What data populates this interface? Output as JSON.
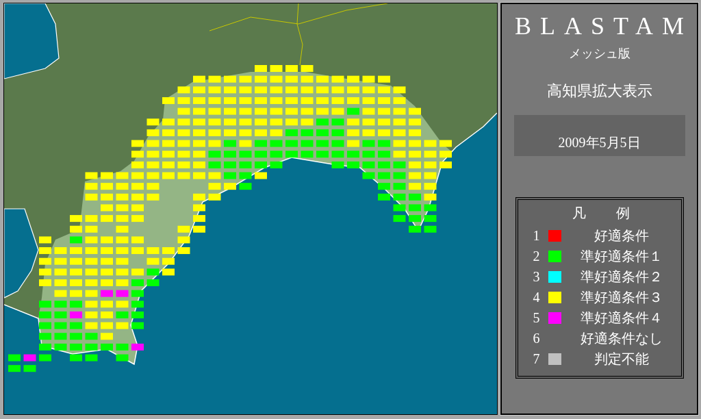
{
  "panel": {
    "title": "BLASTAM",
    "subtitle": "メッシュ版",
    "view": "高知県拡大表示",
    "date": "2009年5月5日"
  },
  "legend": {
    "title": "凡例",
    "items": [
      {
        "number": "1",
        "label": "好適条件",
        "color": "#ff0000"
      },
      {
        "number": "2",
        "label": "準好適条件１",
        "color": "#00ff00"
      },
      {
        "number": "3",
        "label": "準好適条件２",
        "color": "#00ffff"
      },
      {
        "number": "4",
        "label": "準好適条件３",
        "color": "#ffff00"
      },
      {
        "number": "5",
        "label": "準好適条件４",
        "color": "#ff00ff"
      },
      {
        "number": "6",
        "label": "好適条件なし"
      },
      {
        "number": "7",
        "label": "判定不能",
        "color": "#c0c0c0"
      }
    ]
  }
}
